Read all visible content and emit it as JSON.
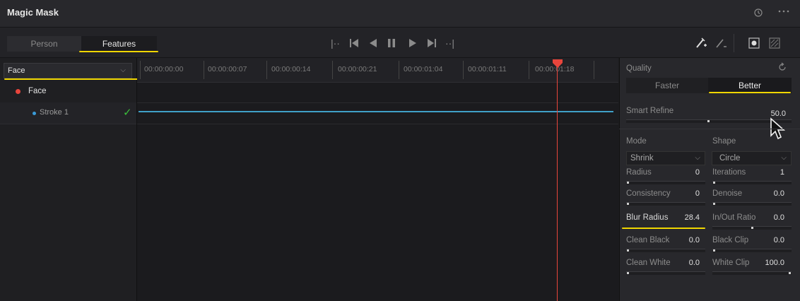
{
  "title": "Magic Mask",
  "header_icons": {
    "history": "history-icon",
    "more": "more-icon"
  },
  "tabs": [
    {
      "label": "Person"
    },
    {
      "label": "Features"
    }
  ],
  "transport_icons": [
    "step-back-icon",
    "skip-start-icon",
    "play-reverse-icon",
    "pause-icon",
    "play-forward-icon",
    "skip-end-icon",
    "step-forward-icon"
  ],
  "tool_icons": [
    "add-stroke-icon",
    "subtract-stroke-icon",
    "mask-overlay-icon",
    "mask-toggle-icon"
  ],
  "feature_select": {
    "value": "Face"
  },
  "tracks": [
    {
      "name": "Face",
      "dot_color": "#e8453c"
    },
    {
      "name": "Stroke 1",
      "dot_color": "#3a9bd8",
      "status": "✓"
    }
  ],
  "timecodes": [
    "00:00:00:00",
    "00:00:00:07",
    "00:00:00:14",
    "00:00:00:21",
    "00:00:01:04",
    "00:00:01:11",
    "00:00:01:18"
  ],
  "playhead_color": "#e8453c",
  "stroke_line_color": "#3fa0c8",
  "right": {
    "quality": {
      "label": "Quality",
      "options": [
        "Faster",
        "Better"
      ],
      "selected": "Better"
    },
    "smart_refine": {
      "label": "Smart Refine",
      "value": "50.0",
      "level": 0.5
    },
    "mode": {
      "label": "Mode",
      "value": "Shrink"
    },
    "shape": {
      "label": "Shape",
      "value": "Circle"
    },
    "params": [
      {
        "label": "Radius",
        "value": "0",
        "level": 0.0
      },
      {
        "label": "Iterations",
        "value": "1",
        "level": 0.0
      },
      {
        "label": "Consistency",
        "value": "0",
        "level": 0.0
      },
      {
        "label": "Denoise",
        "value": "0.0",
        "level": 0.0
      },
      {
        "label": "Blur Radius",
        "value": "28.4",
        "level": 0.52
      },
      {
        "label": "In/Out Ratio",
        "value": "0.0",
        "level": 0.5
      },
      {
        "label": "Clean Black",
        "value": "0.0",
        "level": 0.0
      },
      {
        "label": "Black Clip",
        "value": "0.0",
        "level": 0.0
      },
      {
        "label": "Clean White",
        "value": "0.0",
        "level": 0.0
      },
      {
        "label": "White Clip",
        "value": "100.0",
        "level": 1.0
      }
    ]
  }
}
